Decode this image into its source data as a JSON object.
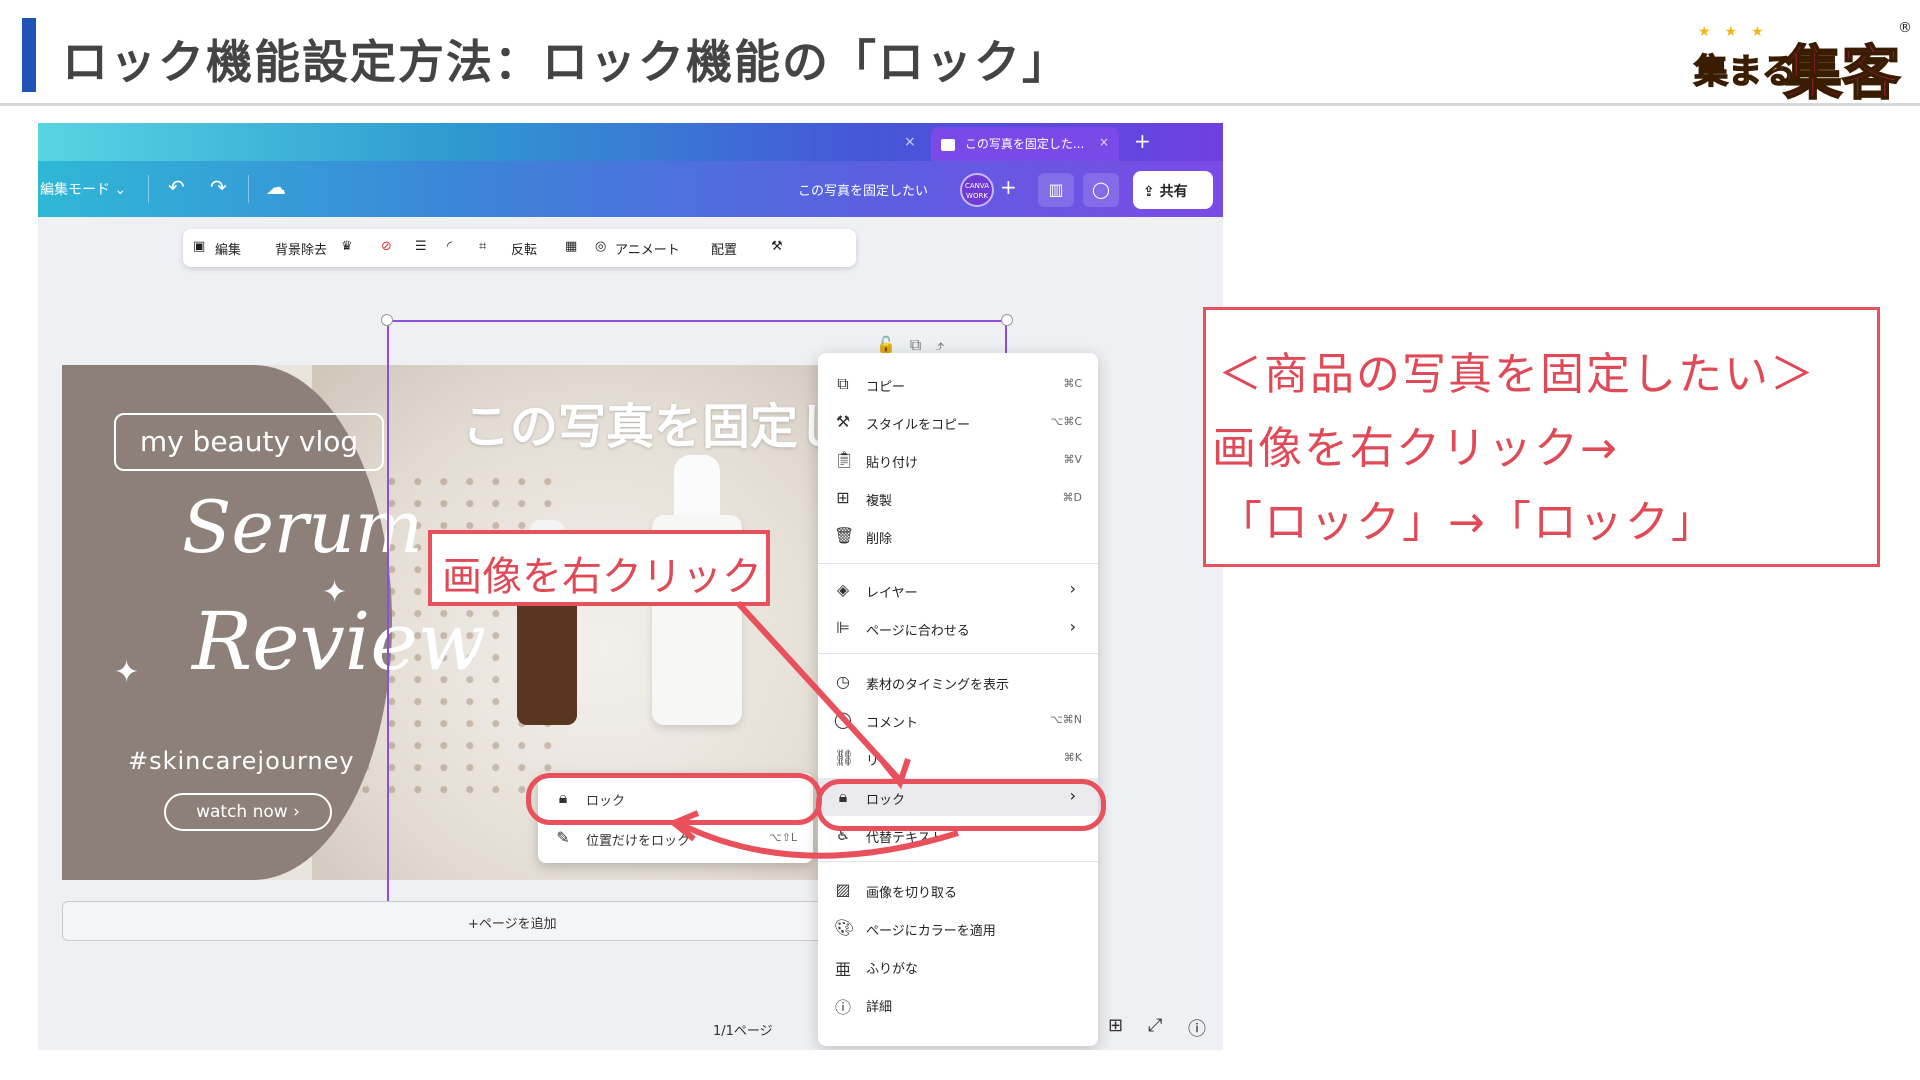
{
  "slide": {
    "title": "ロック機能設定方法：ロック機能の「ロック」",
    "logo_small": "集まる",
    "logo_big": "集客",
    "logo_reg": "®",
    "logo_stars": "★★★"
  },
  "browser": {
    "tab_title": "この写真を固定した...",
    "tab_close": "×",
    "prev_tab_close": "×",
    "new_tab": "+"
  },
  "editor": {
    "edit_mode": "編集モード ⌄",
    "doc_title": "この写真を固定したい",
    "avatar_text": "CANVA WORK",
    "share": "共有",
    "context_toolbar": {
      "edit": "編集",
      "remove_bg": "背景除去",
      "flip": "反転",
      "animate": "アニメート",
      "arrange": "配置"
    },
    "add_page": "+ページを追加",
    "page_indicator": "1/1ページ"
  },
  "design": {
    "pill": "my beauty vlog",
    "script1": "Serum",
    "script2": "Review",
    "hashtag": "#skincarejourney",
    "watch": "watch now  ›",
    "headline": "この写真を固定し"
  },
  "context_menu": {
    "items": [
      {
        "label": "コピー",
        "shortcut": "⌘C",
        "icon": "copy-icon"
      },
      {
        "label": "スタイルをコピー",
        "shortcut": "⌥⌘C",
        "icon": "paint-roller-icon"
      },
      {
        "label": "貼り付け",
        "shortcut": "⌘V",
        "icon": "clipboard-icon"
      },
      {
        "label": "複製",
        "shortcut": "⌘D",
        "icon": "duplicate-icon"
      },
      {
        "label": "削除",
        "shortcut": "",
        "icon": "trash-icon"
      },
      {
        "label": "レイヤー",
        "shortcut": "",
        "icon": "layers-icon"
      },
      {
        "label": "ページに合わせる",
        "shortcut": "",
        "icon": "align-icon"
      },
      {
        "label": "素材のタイミングを表示",
        "shortcut": "",
        "icon": "clock-icon"
      },
      {
        "label": "コメント",
        "shortcut": "⌥⌘N",
        "icon": "comment-icon"
      },
      {
        "label": "リ",
        "shortcut": "⌘K",
        "icon": "link-icon"
      },
      {
        "label": "ロック",
        "shortcut": "",
        "icon": "lock-icon"
      },
      {
        "label": "代替テキスト",
        "shortcut": "",
        "icon": "accessibility-icon"
      },
      {
        "label": "画像を切り取る",
        "shortcut": "",
        "icon": "crop-pattern-icon"
      },
      {
        "label": "ページにカラーを適用",
        "shortcut": "",
        "icon": "palette-icon"
      },
      {
        "label": "ふりがな",
        "shortcut": "",
        "icon": "furigana-icon"
      },
      {
        "label": "詳細",
        "shortcut": "",
        "icon": "info-icon"
      }
    ]
  },
  "submenu": {
    "lock": "ロック",
    "lock_position": "位置だけをロック",
    "lock_position_shortcut": "⌥⇧L"
  },
  "annotations": {
    "callout": "画像を右クリック",
    "note_line1": "＜商品の写真を固定したい＞",
    "note_line2": "画像を右クリック→",
    "note_line3": "「ロック」→「ロック」"
  },
  "colors": {
    "accent_blue": "#1f54b7",
    "annotation_red": "#e8505b",
    "canva_purple": "#7b4be6"
  }
}
